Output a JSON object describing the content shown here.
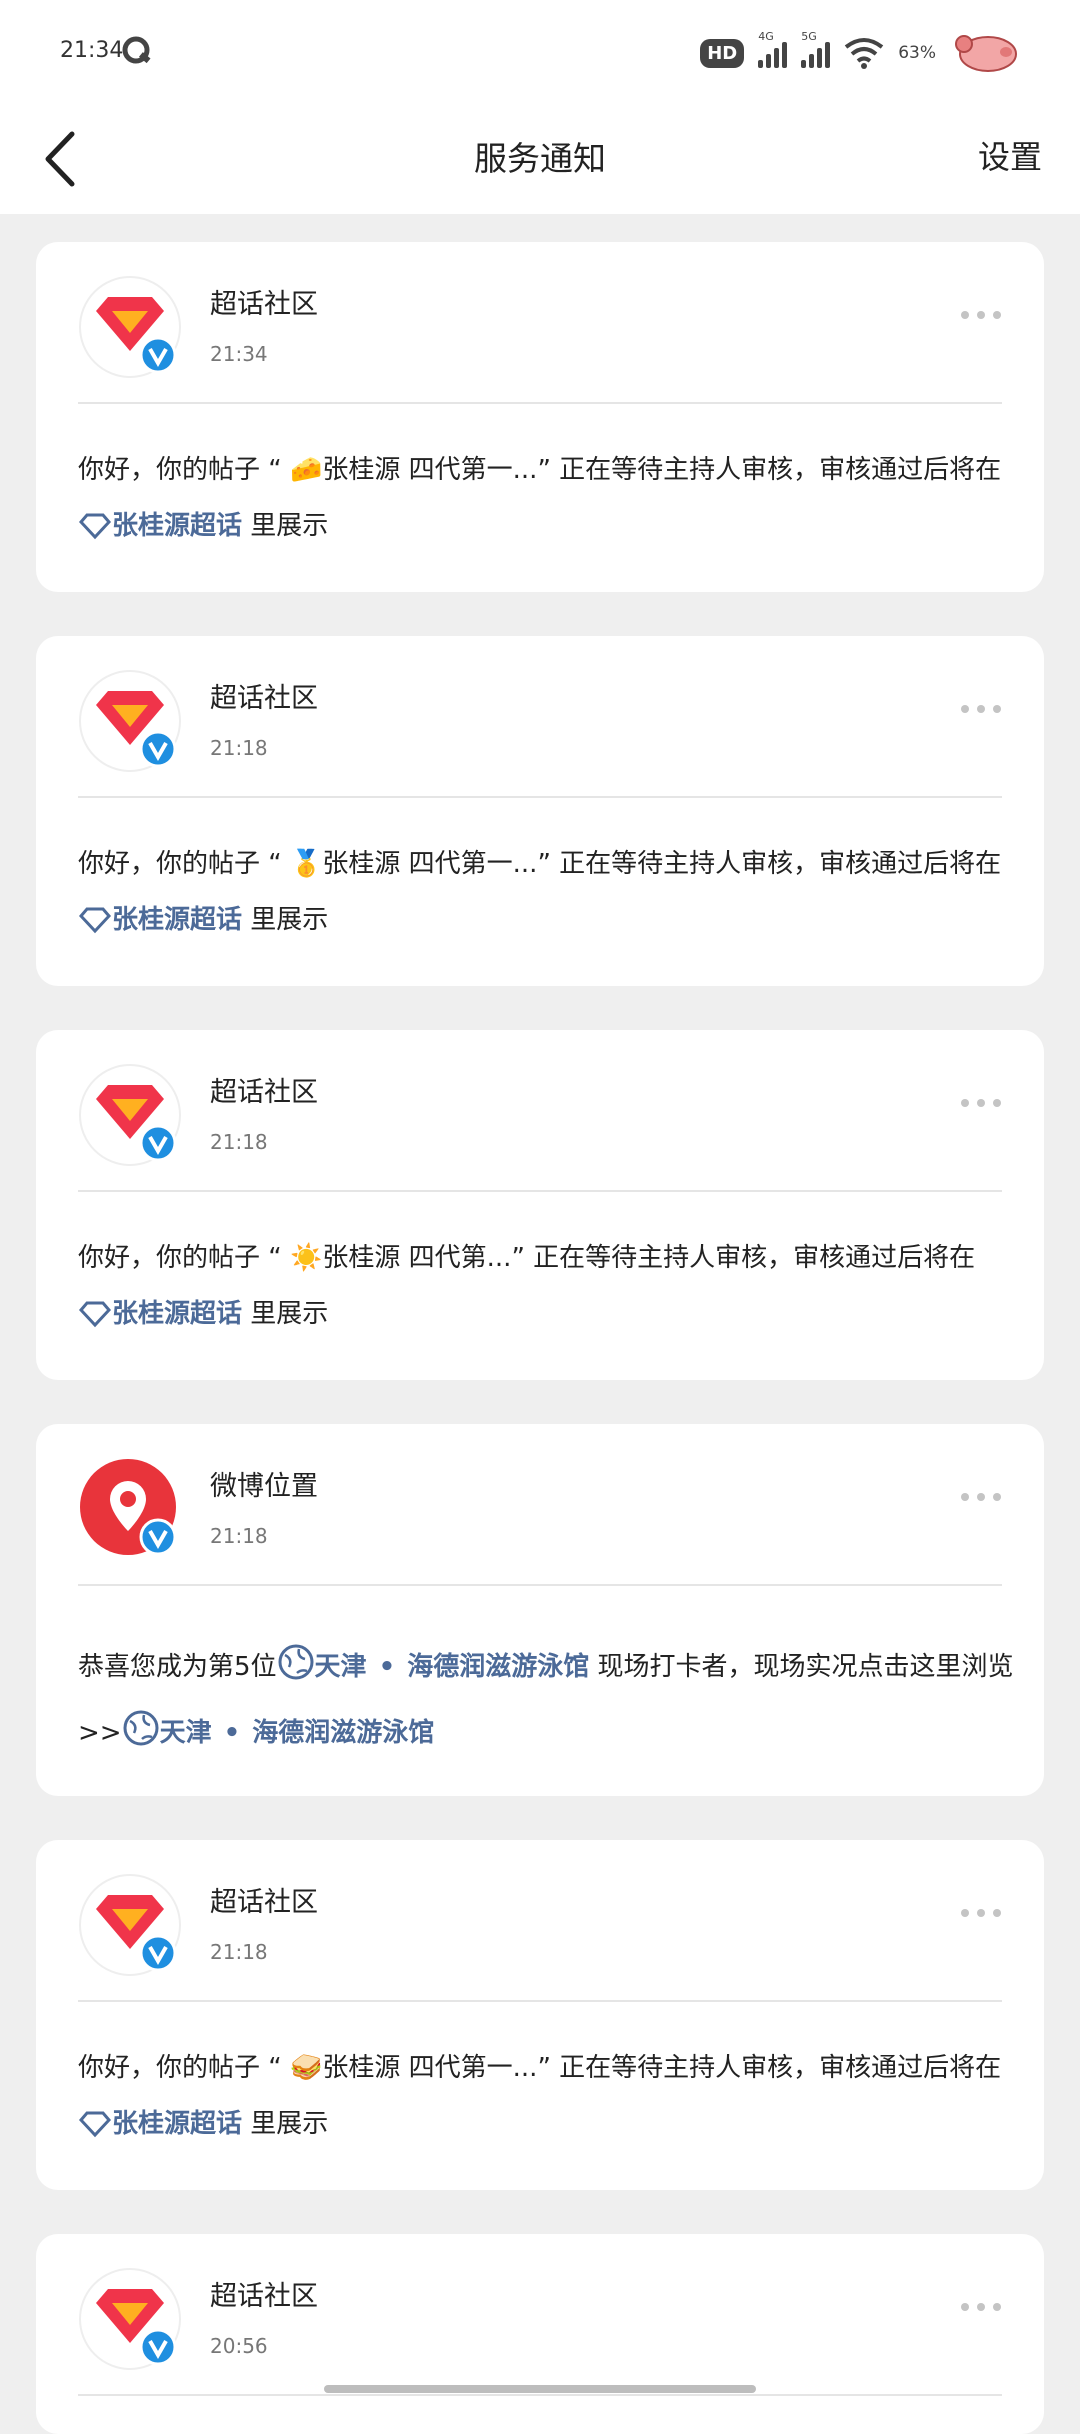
{
  "status": {
    "time": "21:34",
    "battery": "63%",
    "hd": "HD",
    "net1": "4G",
    "net2": "5G"
  },
  "header": {
    "title": "服务通知",
    "settings": "设置"
  },
  "cards": [
    {
      "sender": "超话社区",
      "time": "21:34",
      "pre": "你好，你的帖子 “ ",
      "emoji": "🧀",
      "post_title": "张桂源 四代第一...",
      "mid": "” 正在等待主持人审核，审核通过后将在",
      "link": "张桂源超话",
      "tail": " 里展示"
    },
    {
      "sender": "超话社区",
      "time": "21:18",
      "pre": "你好，你的帖子 “ ",
      "emoji": "🥇",
      "post_title": "张桂源 四代第一...",
      "mid": "” 正在等待主持人审核，审核通过后将在",
      "link": "张桂源超话",
      "tail": " 里展示"
    },
    {
      "sender": "超话社区",
      "time": "21:18",
      "pre": "你好，你的帖子 “ ",
      "emoji": "☀️",
      "post_title": "张桂源 四代第...",
      "mid": "” 正在等待主持人审核，审核通过后将在",
      "link": "张桂源超话",
      "tail": " 里展示"
    },
    {
      "sender": "微博位置",
      "time": "21:18",
      "pre": "恭喜您成为第5位",
      "city": "天津",
      "venue": "海德润滋游泳馆",
      "mid": " 现场打卡者，现场实况点击这里浏览",
      "prefix2": ">>",
      "city2": "天津",
      "venue2": "海德润滋游泳馆"
    },
    {
      "sender": "超话社区",
      "time": "21:18",
      "pre": "你好，你的帖子 “ ",
      "emoji": "🥪",
      "post_title": "张桂源 四代第一...",
      "mid": "” 正在等待主持人审核，审核通过后将在",
      "link": "张桂源超话",
      "tail": " 里展示"
    },
    {
      "sender": "超话社区",
      "time": "20:56"
    }
  ]
}
